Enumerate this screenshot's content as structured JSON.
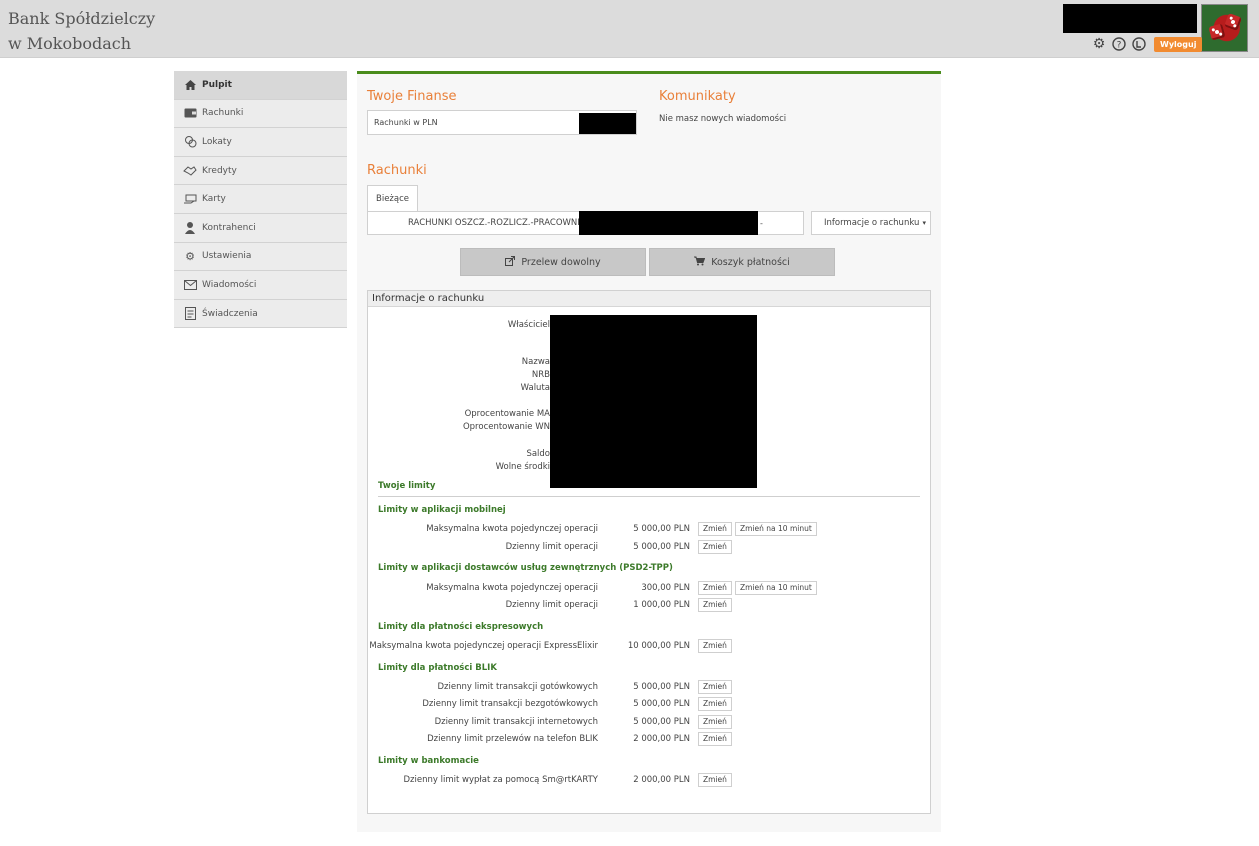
{
  "header": {
    "bank_line1": "Bank Spółdzielczy",
    "bank_line2": "w Mokobodach",
    "logout_label": "Wyloguj",
    "icons": [
      "gear-icon",
      "help-icon",
      "accessibility-icon"
    ]
  },
  "sidebar": {
    "items": [
      {
        "label": "Pulpit",
        "icon": "home-icon",
        "active": true
      },
      {
        "label": "Rachunki",
        "icon": "wallet-icon"
      },
      {
        "label": "Lokaty",
        "icon": "coins-icon"
      },
      {
        "label": "Kredyty",
        "icon": "handshake-icon"
      },
      {
        "label": "Karty",
        "icon": "card-hand-icon"
      },
      {
        "label": "Kontrahenci",
        "icon": "person-icon"
      },
      {
        "label": "Ustawienia",
        "icon": "gear-icon"
      },
      {
        "label": "Wiadomości",
        "icon": "envelope-icon"
      },
      {
        "label": "Świadczenia",
        "icon": "document-icon"
      }
    ]
  },
  "main": {
    "finances_title": "Twoje Finanse",
    "finances_box_label": "Rachunki w PLN",
    "messages_title": "Komunikaty",
    "messages_text": "Nie masz nowych wiadomości",
    "accounts_title": "Rachunki",
    "tab_current": "Bieżące",
    "account_selected": "RACHUNKI OSZCZ.-ROZLICZ.-PRACOWNIK",
    "account_dash": "-",
    "info_dropdown": "Informacje o rachunku",
    "btn_transfer": "Przelew dowolny",
    "btn_cart": "Koszyk płatności"
  },
  "info": {
    "header": "Informacje o rachunku",
    "fields": {
      "owner": "Właściciel",
      "name": "Nazwa",
      "nrb": "NRB",
      "currency": "Waluta",
      "rate_ma": "Oprocentowanie MA",
      "rate_wn": "Oprocentowanie WN",
      "balance": "Saldo",
      "available": "Wolne środki"
    },
    "limits_title": "Twoje limity",
    "change_label": "Zmień",
    "change10_label": "Zmień na 10 minut",
    "groups": [
      {
        "title": "Limity w aplikacji mobilnej",
        "rows": [
          {
            "label": "Maksymalna kwota pojedynczej operacji",
            "value": "5 000,00 PLN",
            "tenmin": true
          },
          {
            "label": "Dzienny limit operacji",
            "value": "5 000,00 PLN"
          }
        ]
      },
      {
        "title": "Limity w aplikacji dostawców usług zewnętrznych (PSD2-TPP)",
        "rows": [
          {
            "label": "Maksymalna kwota pojedynczej operacji",
            "value": "300,00 PLN",
            "tenmin": true
          },
          {
            "label": "Dzienny limit operacji",
            "value": "1 000,00 PLN"
          }
        ]
      },
      {
        "title": "Limity dla płatności ekspresowych",
        "rows": [
          {
            "label": "Maksymalna kwota pojedynczej operacji ExpressElixir",
            "value": "10 000,00 PLN"
          }
        ]
      },
      {
        "title": "Limity dla płatności BLIK",
        "rows": [
          {
            "label": "Dzienny limit transakcji gotówkowych",
            "value": "5 000,00 PLN"
          },
          {
            "label": "Dzienny limit transakcji bezgotówkowych",
            "value": "5 000,00 PLN"
          },
          {
            "label": "Dzienny limit transakcji internetowych",
            "value": "5 000,00 PLN"
          },
          {
            "label": "Dzienny limit przelewów na telefon BLIK",
            "value": "2 000,00 PLN"
          }
        ]
      },
      {
        "title": "Limity w bankomacie",
        "rows": [
          {
            "label": "Dzienny limit wypłat za pomocą Sm@rtKARTY",
            "value": "2 000,00 PLN"
          }
        ]
      }
    ]
  }
}
